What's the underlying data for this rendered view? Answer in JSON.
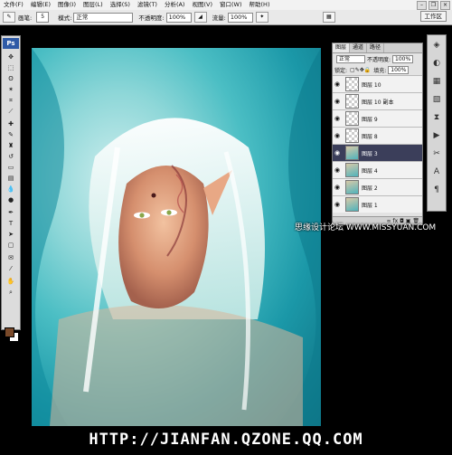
{
  "menubar": {
    "items": [
      "文件(F)",
      "编辑(E)",
      "图像(I)",
      "图层(L)",
      "选择(S)",
      "滤镜(T)",
      "分析(A)",
      "视图(V)",
      "窗口(W)",
      "帮助(H)"
    ]
  },
  "options": {
    "brush_label": "画笔:",
    "brush_size": "5",
    "mode_label": "模式:",
    "mode_value": "正常",
    "opacity_label": "不透明度:",
    "opacity_value": "100%",
    "flow_label": "流量:",
    "flow_value": "100%"
  },
  "workspace_label": "工作区",
  "toolbox": {
    "logo": "Ps",
    "tools": [
      "move-tool",
      "marquee-tool",
      "lasso-tool",
      "magic-wand-tool",
      "crop-tool",
      "slice-tool",
      "healing-brush-tool",
      "brush-tool",
      "clone-stamp-tool",
      "history-brush-tool",
      "eraser-tool",
      "gradient-tool",
      "blur-tool",
      "dodge-tool",
      "pen-tool",
      "type-tool",
      "path-selection-tool",
      "shape-tool",
      "notes-tool",
      "eyedropper-tool",
      "hand-tool",
      "zoom-tool"
    ],
    "foreground_color": "#7a4a2a",
    "background_color": "#ffffff"
  },
  "layers_panel": {
    "tabs": [
      "图层",
      "通道",
      "路径"
    ],
    "blend_mode": "正常",
    "opacity_label": "不透明度:",
    "opacity_value": "100%",
    "lock_label": "锁定:",
    "fill_label": "填充:",
    "fill_value": "100%",
    "layers": [
      {
        "name": "图层 10",
        "active": false,
        "has_image": false
      },
      {
        "name": "图层 10 副本",
        "active": false,
        "has_image": false
      },
      {
        "name": "图层 9",
        "active": false,
        "has_image": false
      },
      {
        "name": "图层 8",
        "active": false,
        "has_image": false
      },
      {
        "name": "图层 3",
        "active": true,
        "has_image": true
      },
      {
        "name": "图层 4",
        "active": false,
        "has_image": true
      },
      {
        "name": "图层 2",
        "active": false,
        "has_image": true
      },
      {
        "name": "图层 1",
        "active": false,
        "has_image": true
      }
    ]
  },
  "watermark": "思缘设计论坛 WWW.MISSYUAN.COM",
  "footer_url": "HTTP://JIANFAN.QZONE.QQ.COM",
  "colors": {
    "active_layer": "#3b3e5a",
    "canvas_teal": "#1b98a8"
  }
}
